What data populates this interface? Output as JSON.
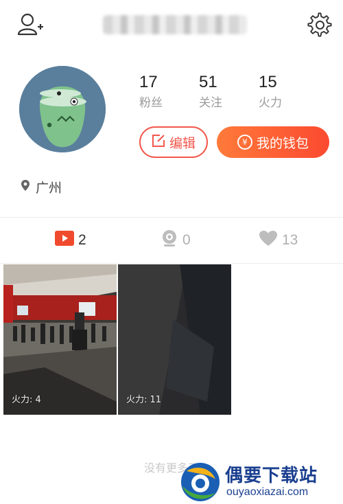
{
  "header": {
    "add_friend_icon": "add-user-icon",
    "settings_icon": "gear-icon"
  },
  "profile": {
    "stats": [
      {
        "value": "17",
        "label": "粉丝"
      },
      {
        "value": "51",
        "label": "关注"
      },
      {
        "value": "15",
        "label": "火力"
      }
    ],
    "edit_label": "编辑",
    "wallet_label": "我的钱包",
    "wallet_symbol": "¥",
    "location": "广州"
  },
  "tabs": [
    {
      "icon": "video-play-icon",
      "count": "2",
      "active": true
    },
    {
      "icon": "webcam-icon",
      "count": "0",
      "active": false
    },
    {
      "icon": "heart-icon",
      "count": "13",
      "active": false
    }
  ],
  "videos": [
    {
      "label": "火力: 4"
    },
    {
      "label": "火力: 11"
    }
  ],
  "footer": {
    "text": "没有更多了"
  },
  "watermark": {
    "title": "偶要下载站",
    "url": "ouyaoxiazai.com"
  },
  "colors": {
    "accent": "#f2574c",
    "wallet_gradient": [
      "#ff7a3a",
      "#fb4a30"
    ],
    "watermark": "#1a3f8f"
  }
}
